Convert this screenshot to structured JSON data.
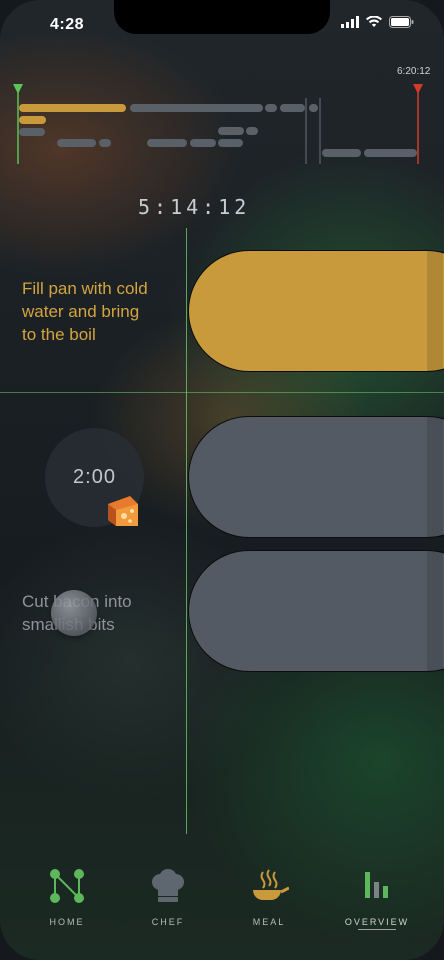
{
  "status_bar": {
    "time": "4:28"
  },
  "timeline": {
    "end_time": "6:20:12",
    "current_time": "5:14:12",
    "start_marker_color": "#5cc35a",
    "end_marker_color": "#d23a2a"
  },
  "tasks": [
    {
      "text_line1": "Fill pan with cold",
      "text_line2": "water and bring",
      "text_line3": "to the boil",
      "state": "active",
      "color": "#c99a3c"
    },
    {
      "timer": "2:00",
      "icon": "cheese-icon",
      "state": "upcoming",
      "color": "#545a63"
    },
    {
      "text_line1": "Cut bacon into",
      "text_line2": "smallish bits",
      "state": "upcoming",
      "color": "#545a63"
    }
  ],
  "tabbar": {
    "items": [
      {
        "label": "HOME",
        "icon": "nodes-icon"
      },
      {
        "label": "CHEF",
        "icon": "chef-hat-icon"
      },
      {
        "label": "MEAL",
        "icon": "pan-icon"
      },
      {
        "label": "OVERVIEW",
        "icon": "bars-icon",
        "active": true
      }
    ]
  }
}
